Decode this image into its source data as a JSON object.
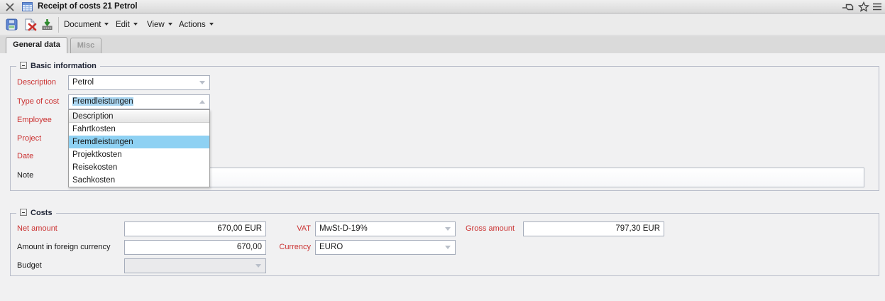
{
  "titlebar": {
    "title": "Receipt of costs 21 Petrol"
  },
  "toolbar": {
    "menus": [
      {
        "label": "Document"
      },
      {
        "label": "Edit"
      },
      {
        "label": "View"
      },
      {
        "label": "Actions"
      }
    ]
  },
  "tabs": [
    {
      "label": "General data",
      "active": true
    },
    {
      "label": "Misc",
      "active": false
    }
  ],
  "basic": {
    "legend": "Basic information",
    "description": {
      "label": "Description",
      "value": "Petrol"
    },
    "type_of_cost": {
      "label": "Type of cost",
      "value": "Fremdleistungen"
    },
    "employee": {
      "label": "Employee",
      "value": ""
    },
    "project": {
      "label": "Project",
      "value": ""
    },
    "date": {
      "label": "Date",
      "value": ""
    },
    "note": {
      "label": "Note",
      "value": ""
    },
    "type_dropdown": {
      "options": [
        {
          "label": "Description"
        },
        {
          "label": "Fahrtkosten"
        },
        {
          "label": "Fremdleistungen"
        },
        {
          "label": "Projektkosten"
        },
        {
          "label": "Reisekosten"
        },
        {
          "label": "Sachkosten"
        }
      ],
      "selected": "Fremdleistungen"
    }
  },
  "costs": {
    "legend": "Costs",
    "net_amount": {
      "label": "Net amount",
      "value": "670,00 EUR"
    },
    "vat": {
      "label": "VAT",
      "value": "MwSt-D-19%"
    },
    "gross_amount": {
      "label": "Gross amount",
      "value": "797,30 EUR"
    },
    "foreign_amount": {
      "label": "Amount in foreign currency",
      "value": "670,00"
    },
    "currency": {
      "label": "Currency",
      "value": "EURO"
    },
    "budget": {
      "label": "Budget",
      "value": ""
    }
  },
  "colors": {
    "required_label": "#cb3232",
    "dropdown_selection": "#8ed1f3",
    "text_selection": "#abd7f2",
    "groupbox_border": "#b9bdca"
  }
}
